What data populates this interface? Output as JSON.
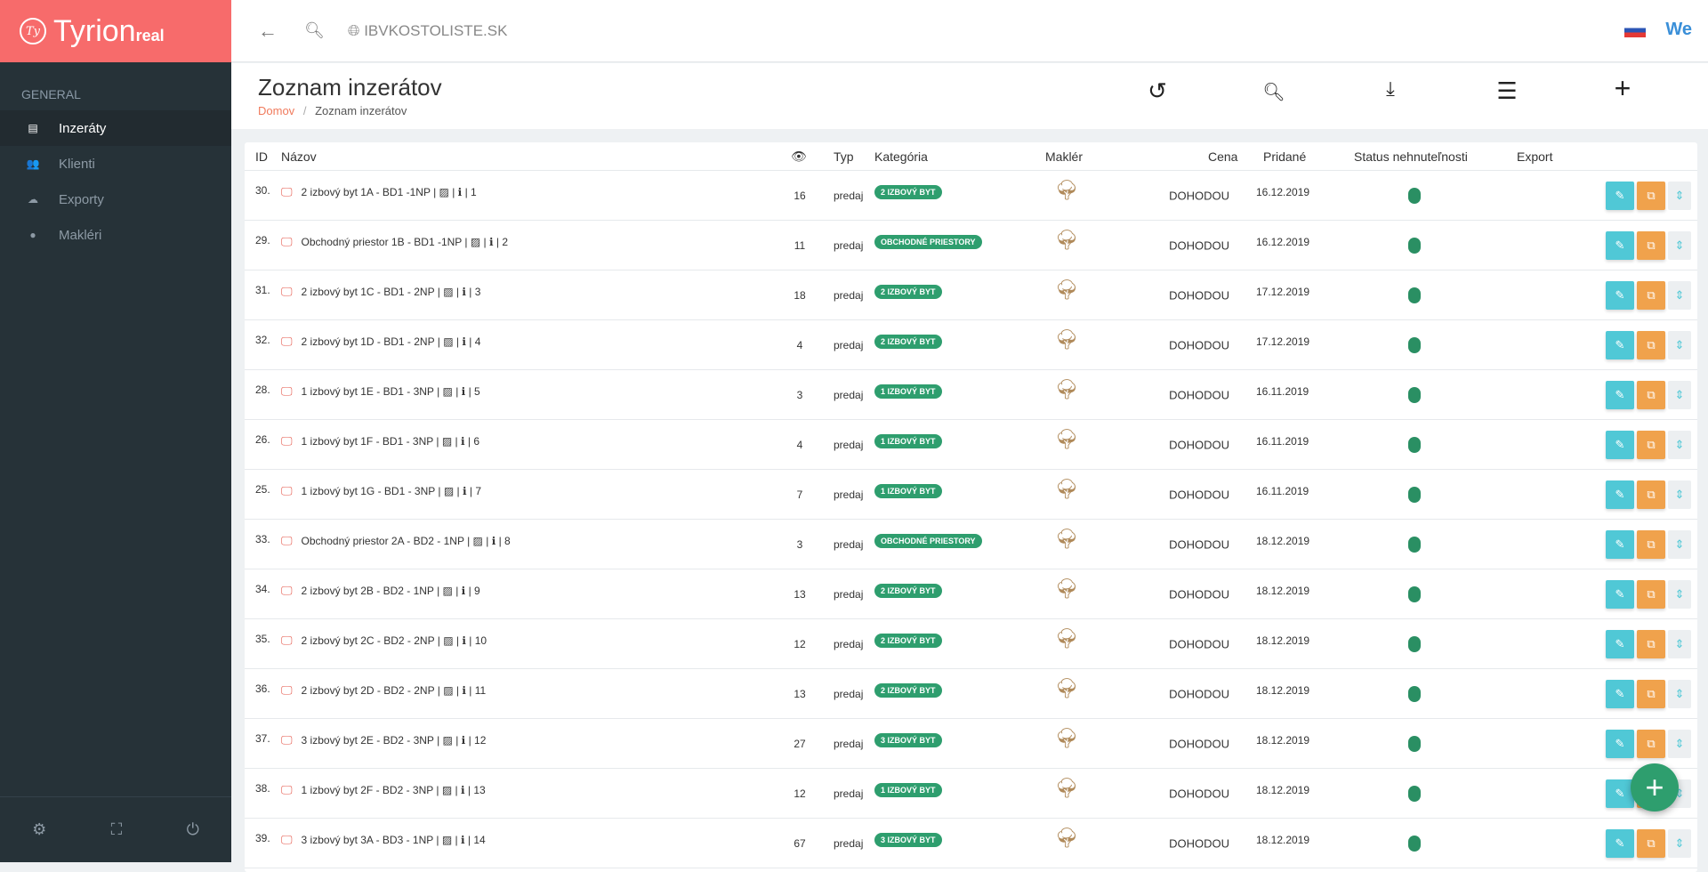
{
  "app": {
    "logo_text": "Tyrion",
    "logo_suffix": "real",
    "logo_mark": "Ty"
  },
  "sidebar": {
    "section": "GENERAL",
    "items": [
      {
        "label": "Inzeráty",
        "icon": "clipboard-icon"
      },
      {
        "label": "Klienti",
        "icon": "users-icon"
      },
      {
        "label": "Exporty",
        "icon": "cloud-upload-icon"
      },
      {
        "label": "Makléri",
        "icon": "user-icon"
      }
    ]
  },
  "topbar": {
    "url": "IBVKOSTOLISTE.SK",
    "user": "We"
  },
  "page": {
    "title": "Zoznam inzerátov",
    "breadcrumb_home": "Domov",
    "breadcrumb_sep": "/",
    "breadcrumb_current": "Zoznam inzerátov"
  },
  "table": {
    "headers": {
      "id": "ID",
      "name": "Názov",
      "views": "👁",
      "type": "Typ",
      "category": "Kategória",
      "agent": "Maklér",
      "price": "Cena",
      "added": "Pridané",
      "status": "Status nehnuteľnosti",
      "export": "Export"
    },
    "rows": [
      {
        "id": "30.",
        "name": "2 izbový byt 1A - BD1 -1NP",
        "num": "1",
        "views": "16",
        "type": "predaj",
        "category": "2 IZBOVÝ BYT",
        "price": "DOHODOU",
        "added": "16.12.2019"
      },
      {
        "id": "29.",
        "name": "Obchodný priestor 1B - BD1 -1NP",
        "num": "2",
        "views": "11",
        "type": "predaj",
        "category": "OBCHODNÉ PRIESTORY",
        "price": "DOHODOU",
        "added": "16.12.2019"
      },
      {
        "id": "31.",
        "name": "2 izbový byt 1C - BD1 - 2NP",
        "num": "3",
        "views": "18",
        "type": "predaj",
        "category": "2 IZBOVÝ BYT",
        "price": "DOHODOU",
        "added": "17.12.2019"
      },
      {
        "id": "32.",
        "name": "2 izbový byt 1D - BD1 - 2NP",
        "num": "4",
        "views": "4",
        "type": "predaj",
        "category": "2 IZBOVÝ BYT",
        "price": "DOHODOU",
        "added": "17.12.2019"
      },
      {
        "id": "28.",
        "name": "1 izbový byt 1E - BD1 - 3NP",
        "num": "5",
        "views": "3",
        "type": "predaj",
        "category": "1 IZBOVÝ BYT",
        "price": "DOHODOU",
        "added": "16.11.2019"
      },
      {
        "id": "26.",
        "name": "1 izbový byt 1F - BD1 - 3NP",
        "num": "6",
        "views": "4",
        "type": "predaj",
        "category": "1 IZBOVÝ BYT",
        "price": "DOHODOU",
        "added": "16.11.2019"
      },
      {
        "id": "25.",
        "name": "1 izbový byt 1G - BD1 - 3NP",
        "num": "7",
        "views": "7",
        "type": "predaj",
        "category": "1 IZBOVÝ BYT",
        "price": "DOHODOU",
        "added": "16.11.2019"
      },
      {
        "id": "33.",
        "name": "Obchodný priestor 2A - BD2 - 1NP",
        "num": "8",
        "views": "3",
        "type": "predaj",
        "category": "OBCHODNÉ PRIESTORY",
        "price": "DOHODOU",
        "added": "18.12.2019"
      },
      {
        "id": "34.",
        "name": "2 izbový byt 2B - BD2 - 1NP",
        "num": "9",
        "views": "13",
        "type": "predaj",
        "category": "2 IZBOVÝ BYT",
        "price": "DOHODOU",
        "added": "18.12.2019"
      },
      {
        "id": "35.",
        "name": "2 izbový byt 2C - BD2 - 2NP",
        "num": "10",
        "views": "12",
        "type": "predaj",
        "category": "2 IZBOVÝ BYT",
        "price": "DOHODOU",
        "added": "18.12.2019"
      },
      {
        "id": "36.",
        "name": "2 izbový byt 2D - BD2 - 2NP",
        "num": "11",
        "views": "13",
        "type": "predaj",
        "category": "2 IZBOVÝ BYT",
        "price": "DOHODOU",
        "added": "18.12.2019"
      },
      {
        "id": "37.",
        "name": "3 izbový byt 2E - BD2 - 3NP",
        "num": "12",
        "views": "27",
        "type": "predaj",
        "category": "3 IZBOVÝ BYT",
        "price": "DOHODOU",
        "added": "18.12.2019"
      },
      {
        "id": "38.",
        "name": "1 izbový byt 2F - BD2 - 3NP",
        "num": "13",
        "views": "12",
        "type": "predaj",
        "category": "1 IZBOVÝ BYT",
        "price": "DOHODOU",
        "added": "18.12.2019"
      },
      {
        "id": "39.",
        "name": "3 izbový byt 3A - BD3 - 1NP",
        "num": "14",
        "views": "67",
        "type": "predaj",
        "category": "3 IZBOVÝ BYT",
        "price": "DOHODOU",
        "added": "18.12.2019"
      }
    ]
  },
  "colors": {
    "brand": "#f76b6b",
    "sidebar": "#263238",
    "badge": "#2e9e6e",
    "edit": "#50c8d6",
    "copy": "#f0a24c"
  }
}
